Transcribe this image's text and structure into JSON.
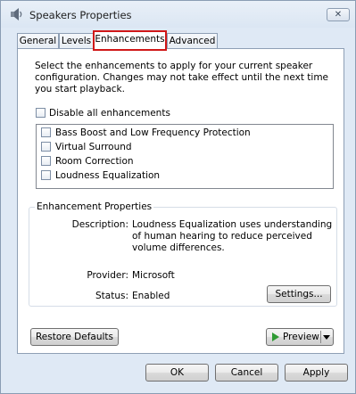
{
  "window": {
    "title": "Speakers Properties",
    "close_glyph": "✕"
  },
  "tabs": [
    {
      "label": "General"
    },
    {
      "label": "Levels"
    },
    {
      "label": "Enhancements"
    },
    {
      "label": "Advanced"
    }
  ],
  "active_tab": "Enhancements",
  "enhancements": {
    "intro_text": "Select the enhancements to apply for your current speaker configuration. Changes may not take effect until the next time you start playback.",
    "disable_all_label": "Disable all enhancements",
    "disable_all_checked": false,
    "items": [
      {
        "label": "Bass Boost and Low Frequency Protection",
        "checked": false
      },
      {
        "label": "Virtual Surround",
        "checked": false
      },
      {
        "label": "Room Correction",
        "checked": false
      },
      {
        "label": "Loudness Equalization",
        "checked": false
      }
    ]
  },
  "properties": {
    "group_title": "Enhancement Properties",
    "description_label": "Description:",
    "description_text": "Loudness Equalization uses understanding of human hearing to reduce perceived volume differences.",
    "provider_label": "Provider:",
    "provider_value": "Microsoft",
    "status_label": "Status:",
    "status_value": "Enabled",
    "settings_button": "Settings..."
  },
  "buttons": {
    "restore_defaults": "Restore Defaults",
    "preview": "Preview",
    "ok": "OK",
    "cancel": "Cancel",
    "apply": "Apply"
  },
  "colors": {
    "active_tab_highlight": "#d01818",
    "preview_play": "#2e9a33"
  }
}
